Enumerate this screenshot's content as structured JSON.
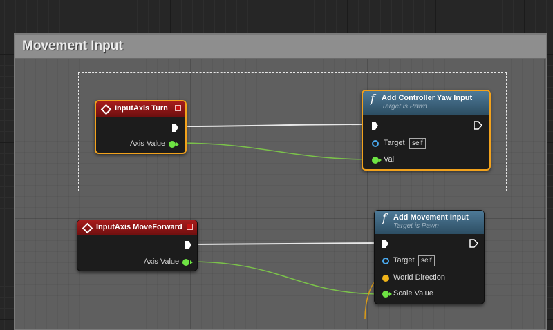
{
  "comment": {
    "title": "Movement Input"
  },
  "nodes": {
    "turn_event": {
      "title": "InputAxis Turn",
      "axis_label": "Axis Value"
    },
    "yaw_input": {
      "title": "Add Controller Yaw Input",
      "subtitle": "Target is Pawn",
      "target_label": "Target",
      "target_value": "self",
      "val_label": "Val"
    },
    "forward_event": {
      "title": "InputAxis MoveForward",
      "axis_label": "Axis Value"
    },
    "movement_input": {
      "title": "Add Movement Input",
      "subtitle": "Target is Pawn",
      "target_label": "Target",
      "target_value": "self",
      "direction_label": "World Direction",
      "scale_label": "Scale Value"
    }
  },
  "colors": {
    "event_header": "#a61c1c",
    "function_header": "#4e7a98",
    "selection_outline": "#f2a21c",
    "float_pin": "#6ee343",
    "vector_pin": "#f0b419",
    "object_pin": "#4aa9ee",
    "exec_wire": "#ffffff"
  },
  "icons": {
    "event_icon": "diamond-outline-icon",
    "function_icon": "function-f-icon",
    "exec_pin": "exec-arrow-icon",
    "data_pin": "pin-dot-icon"
  }
}
